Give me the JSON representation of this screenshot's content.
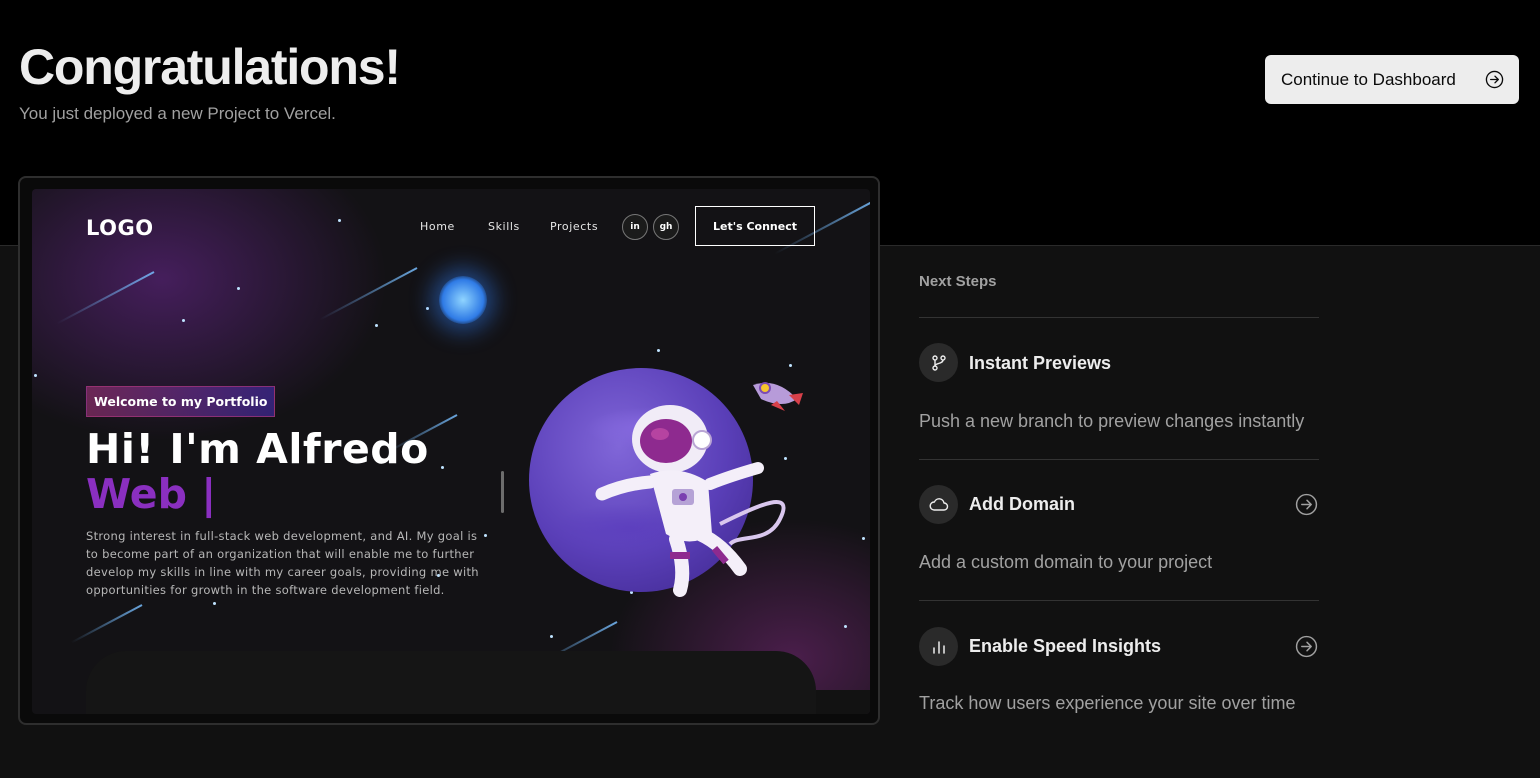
{
  "header": {
    "title": "Congratulations!",
    "subtitle": "You just deployed a new Project to Vercel.",
    "continue_label": "Continue to Dashboard"
  },
  "preview": {
    "logo": "LOGO",
    "nav": [
      "Home",
      "Skills",
      "Projects"
    ],
    "social": [
      "in",
      "gh"
    ],
    "connect_label": "Let's Connect",
    "welcome": "Welcome to my Portfolio",
    "name": "Hi! I'm Alfredo",
    "role": "Web |",
    "description": "Strong interest in full-stack web development, and AI. My goal is to become part of an organization that will enable me to further develop my skills in line with my career goals, providing me with opportunities for growth in the software development field."
  },
  "next_steps": {
    "heading": "Next Steps",
    "items": [
      {
        "title": "Instant Previews",
        "description": "Push a new branch to preview changes instantly",
        "icon": "git-branch-icon"
      },
      {
        "title": "Add Domain",
        "description": "Add a custom domain to your project",
        "icon": "cloud-icon"
      },
      {
        "title": "Enable Speed Insights",
        "description": "Track how users experience your site over time",
        "icon": "bar-chart-icon"
      }
    ]
  },
  "colors": {
    "background_top": "#000000",
    "background_bottom": "#111111",
    "primary_text": "#ededed",
    "secondary_text": "#a1a1a1",
    "button_bg": "#ededed",
    "accent_purple": "#8a2fc0"
  }
}
